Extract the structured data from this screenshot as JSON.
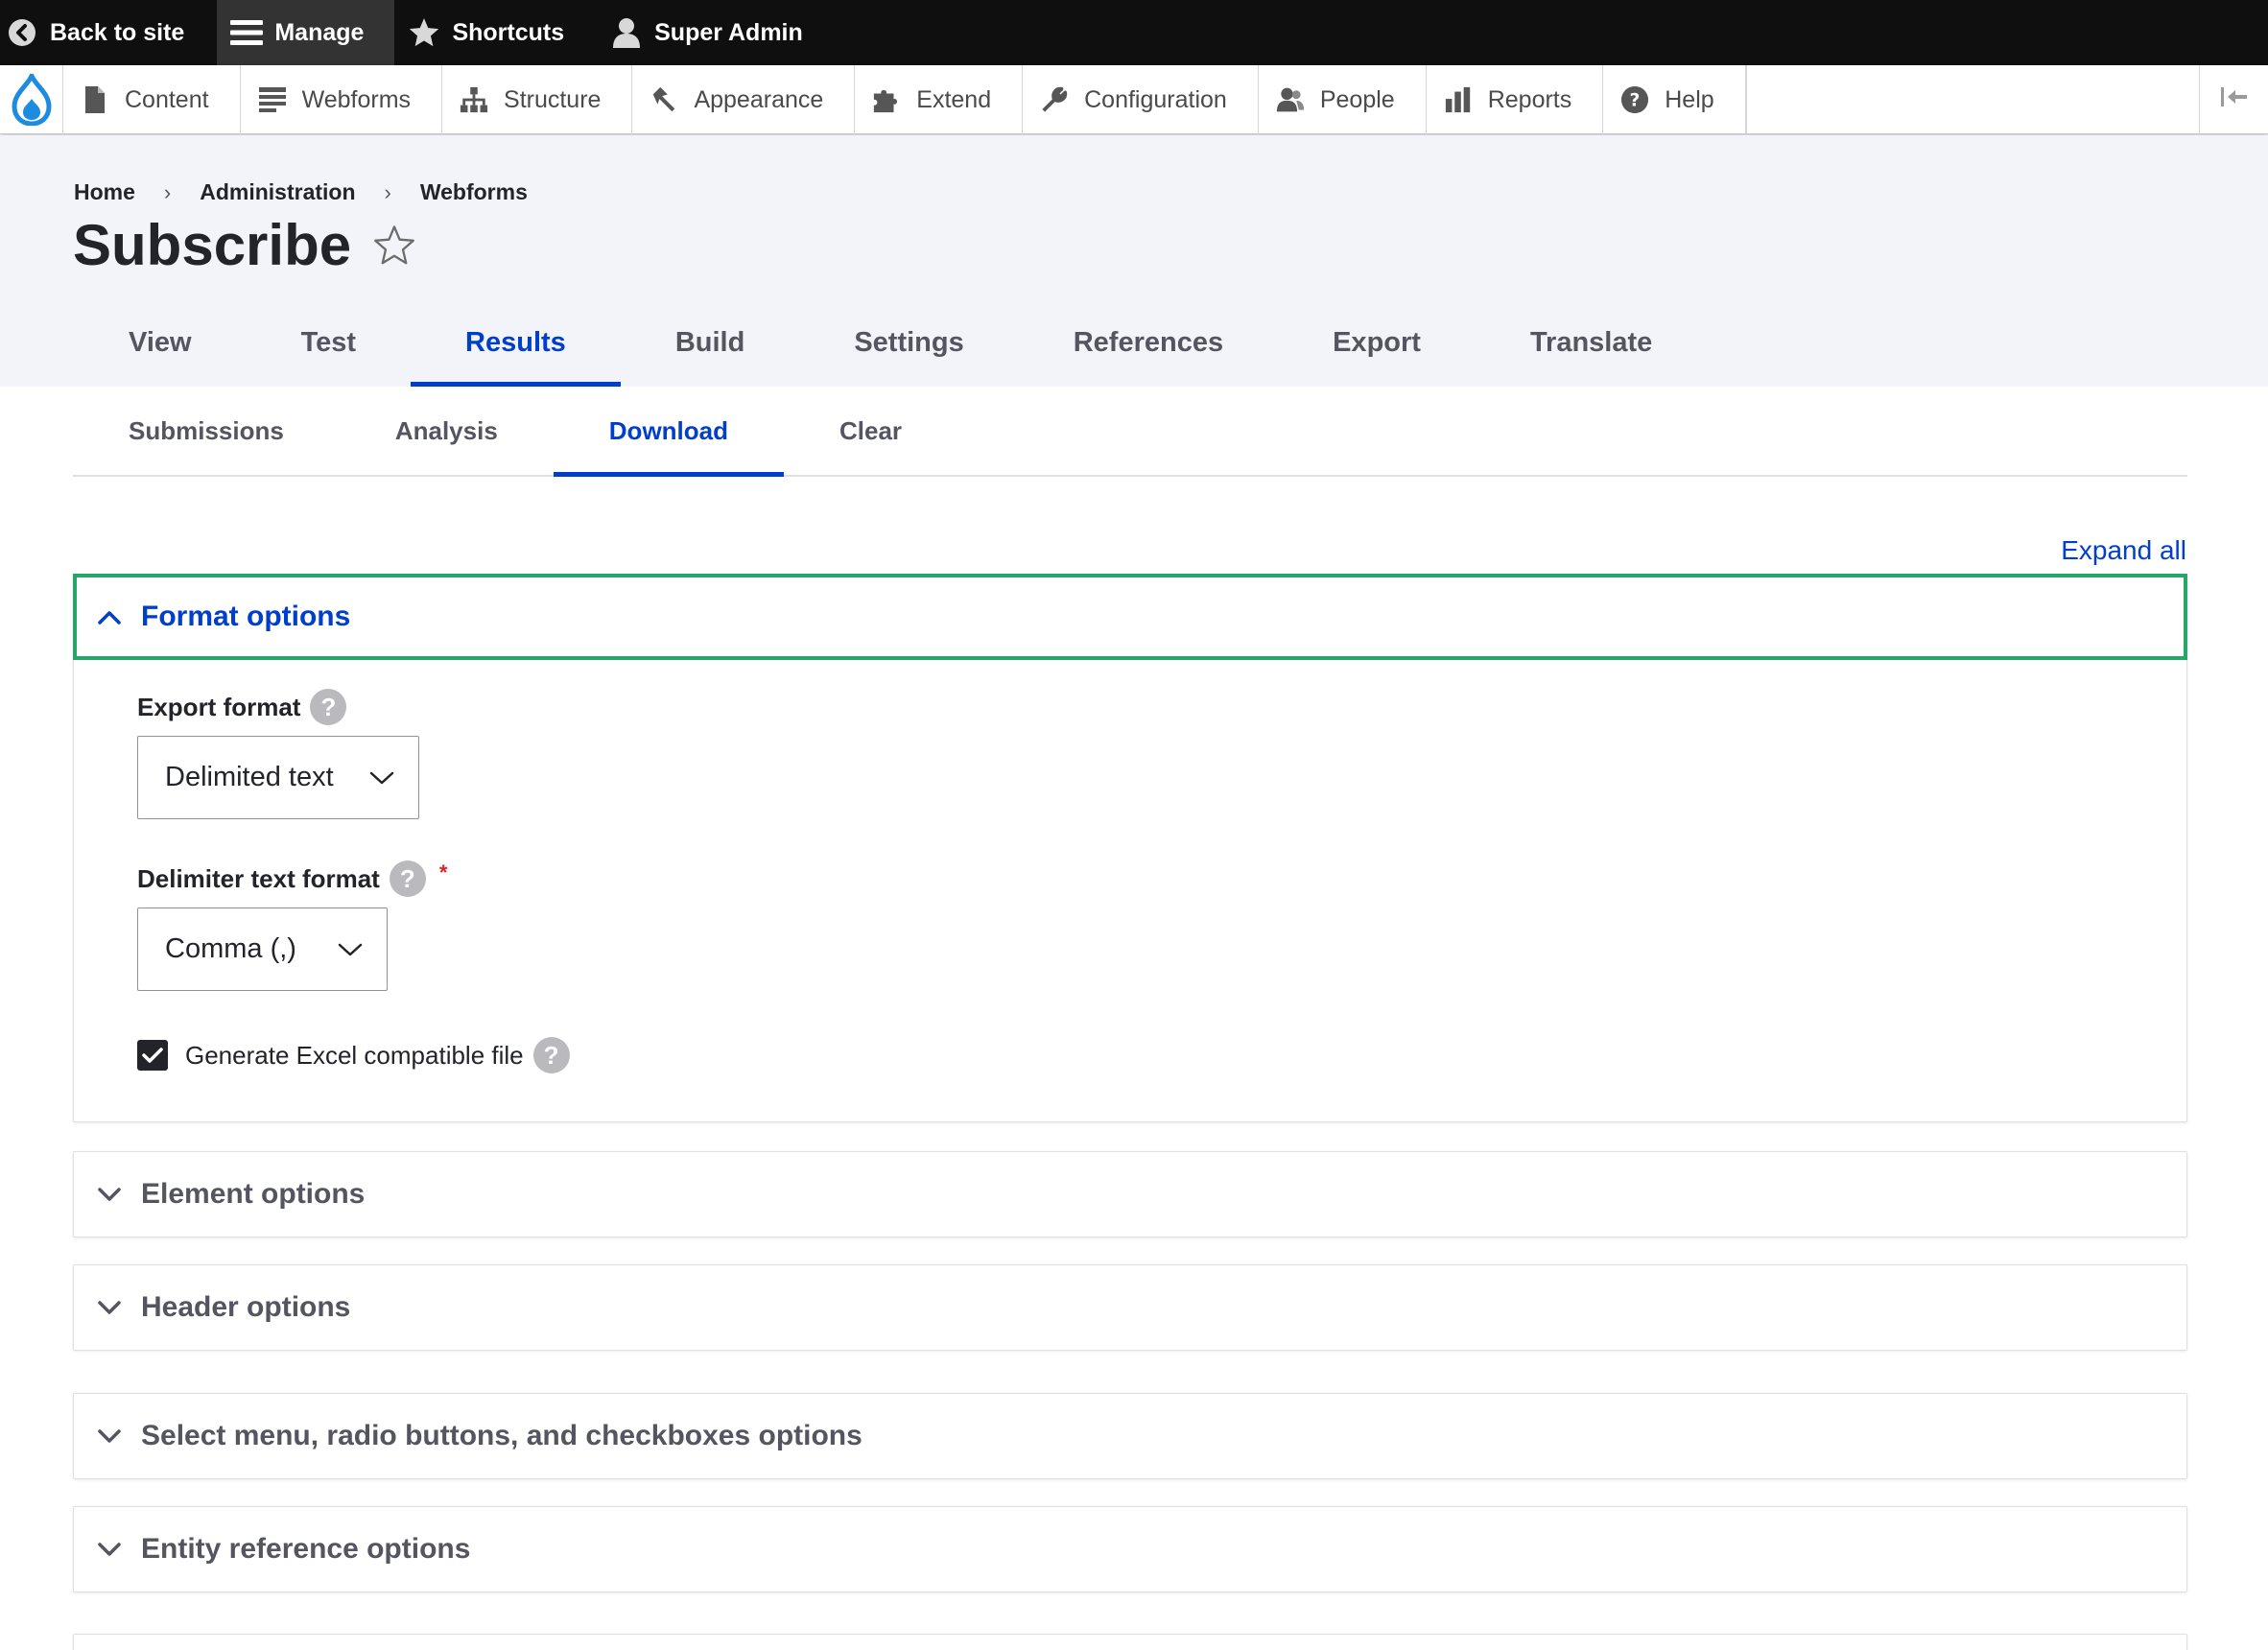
{
  "toolbar": {
    "back_label": "Back to site",
    "manage_label": "Manage",
    "shortcuts_label": "Shortcuts",
    "user_label": "Super Admin"
  },
  "admin_menu": {
    "items": [
      {
        "label": "Content",
        "icon": "document-icon"
      },
      {
        "label": "Webforms",
        "icon": "list-icon"
      },
      {
        "label": "Structure",
        "icon": "sitemap-icon"
      },
      {
        "label": "Appearance",
        "icon": "paintbrush-icon"
      },
      {
        "label": "Extend",
        "icon": "puzzle-icon"
      },
      {
        "label": "Configuration",
        "icon": "wrench-icon"
      },
      {
        "label": "People",
        "icon": "people-icon"
      },
      {
        "label": "Reports",
        "icon": "bar-chart-icon"
      },
      {
        "label": "Help",
        "icon": "help-icon"
      }
    ]
  },
  "breadcrumb": [
    "Home",
    "Administration",
    "Webforms"
  ],
  "page_title": "Subscribe",
  "primary_tabs": [
    "View",
    "Test",
    "Results",
    "Build",
    "Settings",
    "References",
    "Export",
    "Translate"
  ],
  "primary_active": "Results",
  "secondary_tabs": [
    "Submissions",
    "Analysis",
    "Download",
    "Clear"
  ],
  "secondary_active": "Download",
  "expand_all_label": "Expand all",
  "format_options": {
    "title": "Format options",
    "export_format_label": "Export format",
    "export_format_value": "Delimited text",
    "delimiter_label": "Delimiter text format",
    "delimiter_value": "Comma (,)",
    "excel_label": "Generate Excel compatible file",
    "excel_checked": true
  },
  "collapsed_sections": [
    "Element options",
    "Header options",
    "Select menu, radio buttons, and checkboxes options",
    "Entity reference options"
  ],
  "colors": {
    "accent": "#003ecc",
    "focus_outline": "#26a769",
    "required": "#dc2323",
    "toolbar_bg": "#0f0f0f"
  }
}
